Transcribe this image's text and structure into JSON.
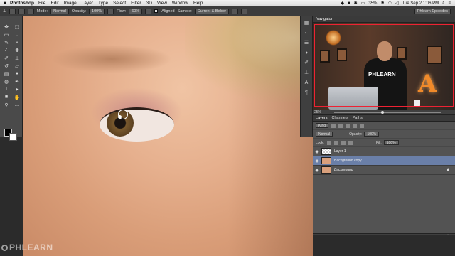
{
  "menubar": {
    "app": "Photoshop",
    "items": [
      "File",
      "Edit",
      "Image",
      "Layer",
      "Type",
      "Select",
      "Filter",
      "3D",
      "View",
      "Window",
      "Help"
    ],
    "battery": "35%",
    "clock": "Tue Sep 2  1:06 PM"
  },
  "options": {
    "mode_label": "Mode:",
    "mode_value": "Normal",
    "opacity_label": "Opacity:",
    "opacity_value": "100%",
    "flow_label": "Flow:",
    "flow_value": "60%",
    "aligned_label": "Aligned",
    "sample_label": "Sample:",
    "sample_value": "Current & Below",
    "workspace": "Phlearn Episodes"
  },
  "navigator": {
    "title": "Navigator",
    "shirt_text": "PHLEARN",
    "letter": "A",
    "zoom": "25%"
  },
  "layers_panel": {
    "tabs": [
      "Layers",
      "Channels",
      "Paths"
    ],
    "kind": "Kind",
    "blend": "Normal",
    "opacity_label": "Opacity:",
    "opacity_value": "100%",
    "lock_label": "Lock:",
    "fill_label": "Fill:",
    "fill_value": "100%",
    "layers": [
      {
        "name": "Layer 1"
      },
      {
        "name": "Background copy"
      },
      {
        "name": "Background"
      }
    ]
  },
  "watermark": "PHLEARN",
  "colors": {
    "selected_layer": "#6a7fa8",
    "panel_bg": "#535353",
    "accent_orange": "#f08a2a"
  }
}
